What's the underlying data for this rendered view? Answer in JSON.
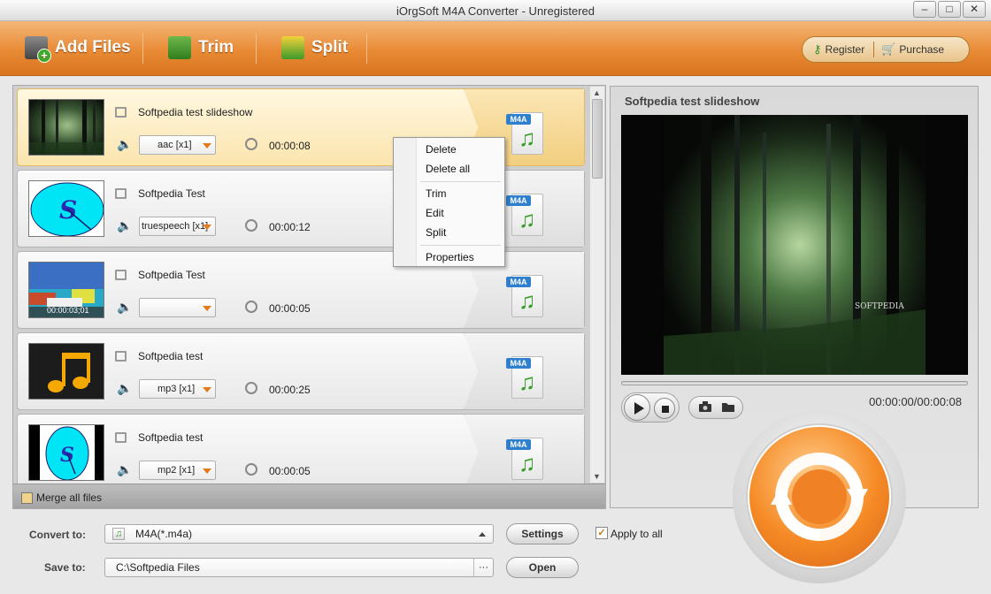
{
  "window": {
    "title": "iOrgSoft M4A Converter - Unregistered",
    "min": "–",
    "max": "□",
    "close": "✕"
  },
  "toolbar": {
    "add_files": "Add Files",
    "trim": "Trim",
    "split": "Split",
    "register": "Register",
    "purchase": "Purchase"
  },
  "files": [
    {
      "name": "Softpedia test slideshow",
      "audio": "aac [x1]",
      "duration": "00:00:08",
      "thumb": "forest",
      "selected": true
    },
    {
      "name": "Softpedia Test",
      "audio": "truespeech [x1]",
      "duration": "00:00:12",
      "thumb": "cyan-oval",
      "selected": false
    },
    {
      "name": "Softpedia Test",
      "audio": "",
      "duration": "00:00:05",
      "thumb": "beach",
      "thumb_time": "00:00:03;01",
      "selected": false
    },
    {
      "name": "Softpedia test",
      "audio": "mp3 [x1]",
      "duration": "00:00:25",
      "thumb": "music-note",
      "selected": false
    },
    {
      "name": "Softpedia test",
      "audio": "mp2 [x1]",
      "duration": "00:00:05",
      "thumb": "cyan-circle",
      "selected": false
    }
  ],
  "output_badge": "M4A",
  "scroll": {
    "up": "▲",
    "down": "▼"
  },
  "merge_label": "Merge all files",
  "context_menu": {
    "delete": "Delete",
    "delete_all": "Delete all",
    "trim": "Trim",
    "edit": "Edit",
    "split": "Split",
    "properties": "Properties"
  },
  "preview": {
    "title": "Softpedia test slideshow",
    "watermark": "SOFTPEDIA",
    "timecode": "00:00:00/00:00:08"
  },
  "bottom": {
    "convert_to_label": "Convert to:",
    "convert_to_value": "M4A(*.m4a)",
    "settings": "Settings",
    "apply_all": "Apply to all",
    "apply_all_checked": true,
    "save_to_label": "Save to:",
    "save_to_value": "C:\\Softpedia Files",
    "browse": "···",
    "open": "Open"
  },
  "colors": {
    "accent_orange": "#e88a35",
    "selected_row": "#fbe5ae",
    "m4a_badge": "#2f7fcf",
    "note_green": "#3a9d2a"
  }
}
